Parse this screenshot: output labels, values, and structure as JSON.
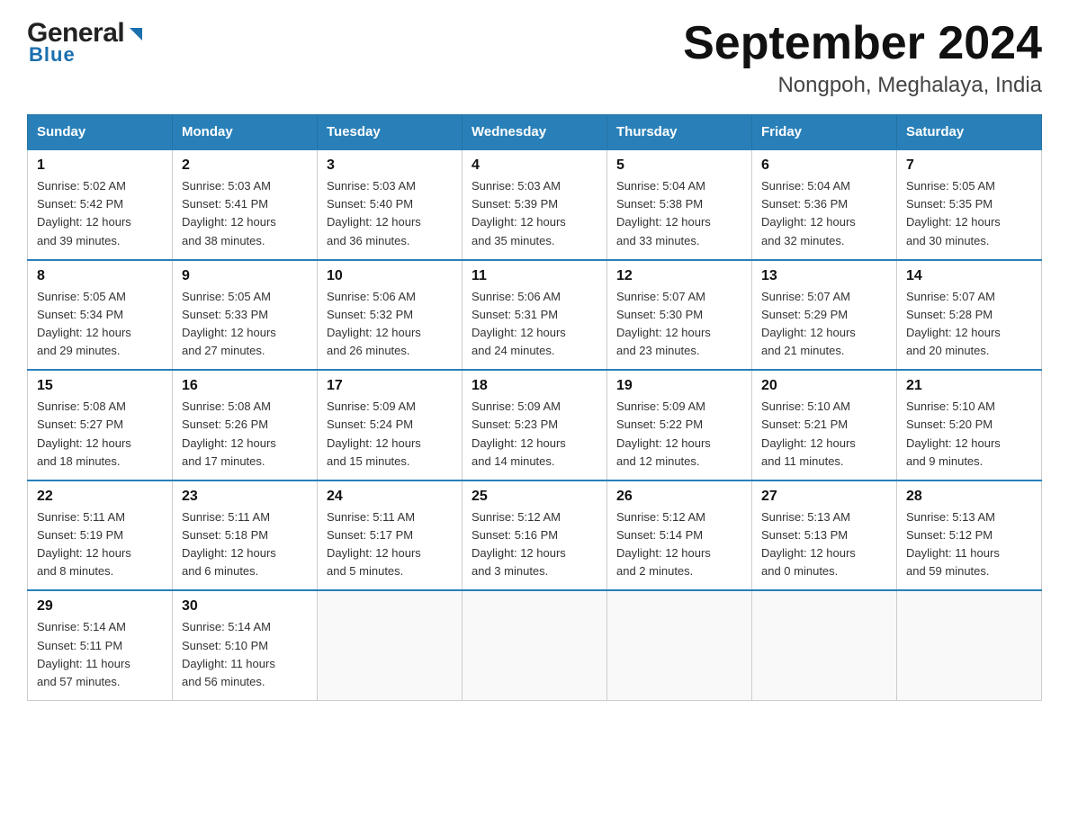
{
  "header": {
    "logo_general": "General",
    "logo_blue": "Blue",
    "month_title": "September 2024",
    "location": "Nongpoh, Meghalaya, India"
  },
  "days_of_week": [
    "Sunday",
    "Monday",
    "Tuesday",
    "Wednesday",
    "Thursday",
    "Friday",
    "Saturday"
  ],
  "weeks": [
    [
      {
        "day": "1",
        "sunrise": "5:02 AM",
        "sunset": "5:42 PM",
        "daylight": "12 hours and 39 minutes."
      },
      {
        "day": "2",
        "sunrise": "5:03 AM",
        "sunset": "5:41 PM",
        "daylight": "12 hours and 38 minutes."
      },
      {
        "day": "3",
        "sunrise": "5:03 AM",
        "sunset": "5:40 PM",
        "daylight": "12 hours and 36 minutes."
      },
      {
        "day": "4",
        "sunrise": "5:03 AM",
        "sunset": "5:39 PM",
        "daylight": "12 hours and 35 minutes."
      },
      {
        "day": "5",
        "sunrise": "5:04 AM",
        "sunset": "5:38 PM",
        "daylight": "12 hours and 33 minutes."
      },
      {
        "day": "6",
        "sunrise": "5:04 AM",
        "sunset": "5:36 PM",
        "daylight": "12 hours and 32 minutes."
      },
      {
        "day": "7",
        "sunrise": "5:05 AM",
        "sunset": "5:35 PM",
        "daylight": "12 hours and 30 minutes."
      }
    ],
    [
      {
        "day": "8",
        "sunrise": "5:05 AM",
        "sunset": "5:34 PM",
        "daylight": "12 hours and 29 minutes."
      },
      {
        "day": "9",
        "sunrise": "5:05 AM",
        "sunset": "5:33 PM",
        "daylight": "12 hours and 27 minutes."
      },
      {
        "day": "10",
        "sunrise": "5:06 AM",
        "sunset": "5:32 PM",
        "daylight": "12 hours and 26 minutes."
      },
      {
        "day": "11",
        "sunrise": "5:06 AM",
        "sunset": "5:31 PM",
        "daylight": "12 hours and 24 minutes."
      },
      {
        "day": "12",
        "sunrise": "5:07 AM",
        "sunset": "5:30 PM",
        "daylight": "12 hours and 23 minutes."
      },
      {
        "day": "13",
        "sunrise": "5:07 AM",
        "sunset": "5:29 PM",
        "daylight": "12 hours and 21 minutes."
      },
      {
        "day": "14",
        "sunrise": "5:07 AM",
        "sunset": "5:28 PM",
        "daylight": "12 hours and 20 minutes."
      }
    ],
    [
      {
        "day": "15",
        "sunrise": "5:08 AM",
        "sunset": "5:27 PM",
        "daylight": "12 hours and 18 minutes."
      },
      {
        "day": "16",
        "sunrise": "5:08 AM",
        "sunset": "5:26 PM",
        "daylight": "12 hours and 17 minutes."
      },
      {
        "day": "17",
        "sunrise": "5:09 AM",
        "sunset": "5:24 PM",
        "daylight": "12 hours and 15 minutes."
      },
      {
        "day": "18",
        "sunrise": "5:09 AM",
        "sunset": "5:23 PM",
        "daylight": "12 hours and 14 minutes."
      },
      {
        "day": "19",
        "sunrise": "5:09 AM",
        "sunset": "5:22 PM",
        "daylight": "12 hours and 12 minutes."
      },
      {
        "day": "20",
        "sunrise": "5:10 AM",
        "sunset": "5:21 PM",
        "daylight": "12 hours and 11 minutes."
      },
      {
        "day": "21",
        "sunrise": "5:10 AM",
        "sunset": "5:20 PM",
        "daylight": "12 hours and 9 minutes."
      }
    ],
    [
      {
        "day": "22",
        "sunrise": "5:11 AM",
        "sunset": "5:19 PM",
        "daylight": "12 hours and 8 minutes."
      },
      {
        "day": "23",
        "sunrise": "5:11 AM",
        "sunset": "5:18 PM",
        "daylight": "12 hours and 6 minutes."
      },
      {
        "day": "24",
        "sunrise": "5:11 AM",
        "sunset": "5:17 PM",
        "daylight": "12 hours and 5 minutes."
      },
      {
        "day": "25",
        "sunrise": "5:12 AM",
        "sunset": "5:16 PM",
        "daylight": "12 hours and 3 minutes."
      },
      {
        "day": "26",
        "sunrise": "5:12 AM",
        "sunset": "5:14 PM",
        "daylight": "12 hours and 2 minutes."
      },
      {
        "day": "27",
        "sunrise": "5:13 AM",
        "sunset": "5:13 PM",
        "daylight": "12 hours and 0 minutes."
      },
      {
        "day": "28",
        "sunrise": "5:13 AM",
        "sunset": "5:12 PM",
        "daylight": "11 hours and 59 minutes."
      }
    ],
    [
      {
        "day": "29",
        "sunrise": "5:14 AM",
        "sunset": "5:11 PM",
        "daylight": "11 hours and 57 minutes."
      },
      {
        "day": "30",
        "sunrise": "5:14 AM",
        "sunset": "5:10 PM",
        "daylight": "11 hours and 56 minutes."
      },
      null,
      null,
      null,
      null,
      null
    ]
  ],
  "labels": {
    "sunrise": "Sunrise:",
    "sunset": "Sunset:",
    "daylight": "Daylight:"
  }
}
